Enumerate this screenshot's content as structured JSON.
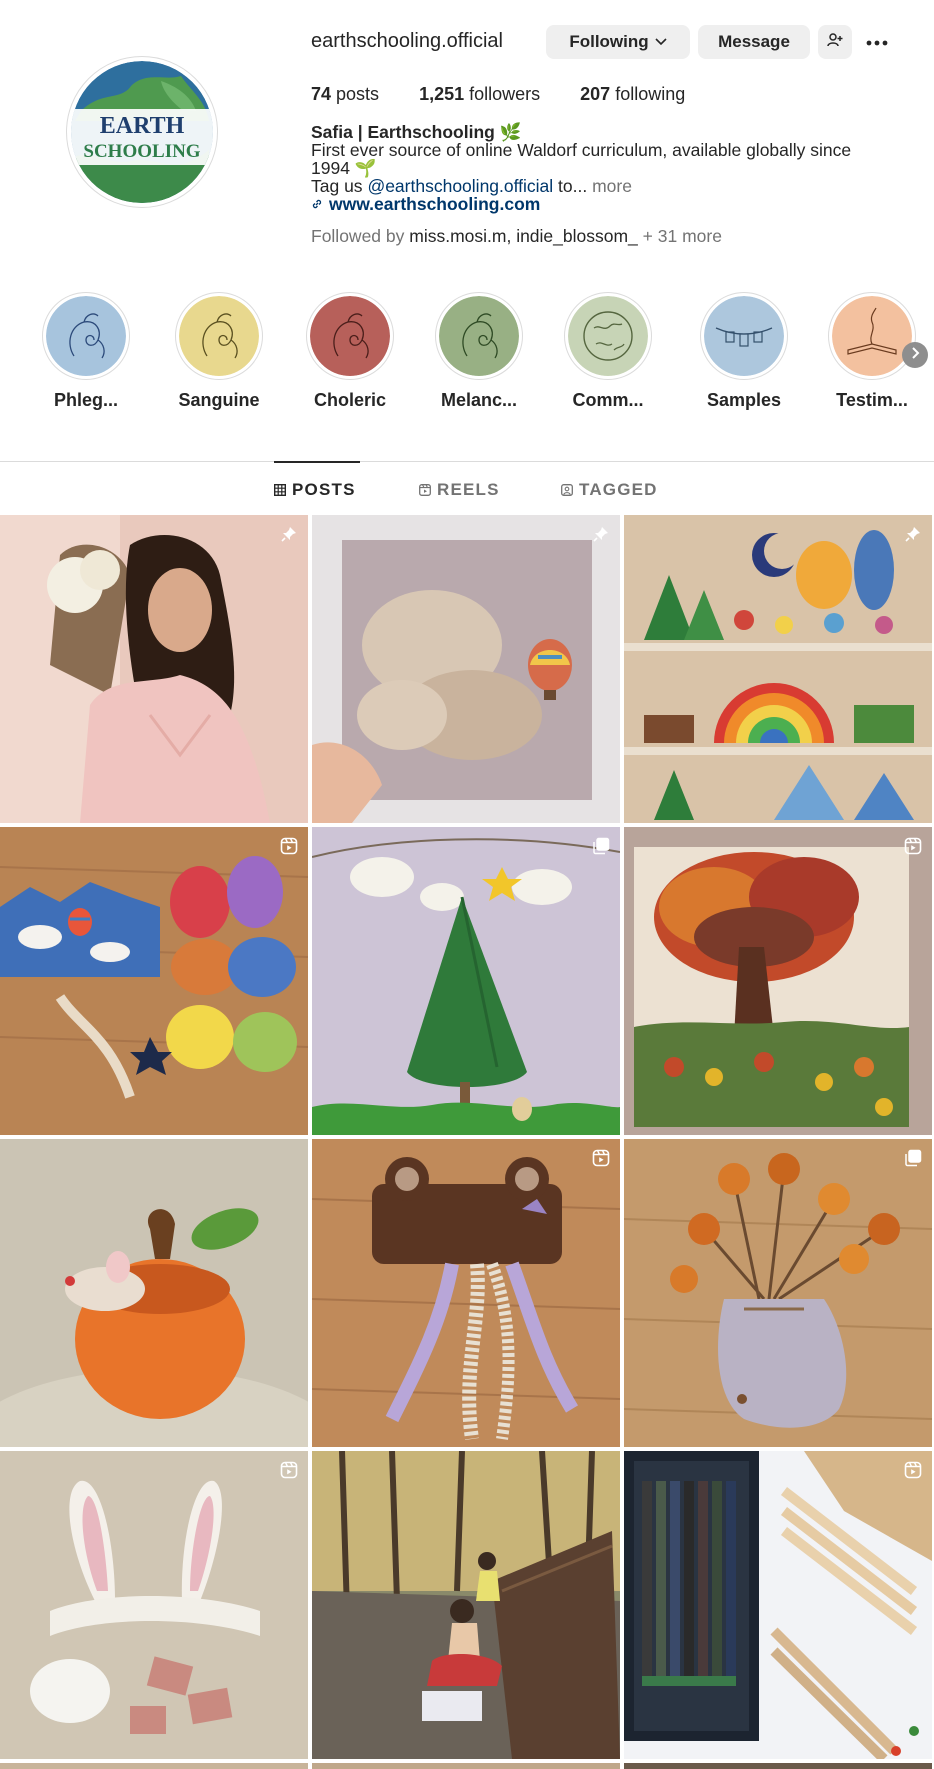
{
  "profile": {
    "username": "earthschooling.official",
    "logo_text_line1": "EARTH",
    "logo_text_line2": "SCHOOLING",
    "following_button": "Following",
    "message_button": "Message",
    "icons": {
      "suggest": "add-person-icon",
      "more": "more-dots-icon",
      "following_dropdown": "chevron-down-icon"
    }
  },
  "stats": {
    "posts_count": "74",
    "posts_label": " posts",
    "followers_count": "1,251",
    "followers_label": " followers",
    "following_count": "207",
    "following_label": " following"
  },
  "bio": {
    "name": "Safia | Earthschooling 🌿",
    "line1": "First ever source of online Waldorf curriculum, available globally since",
    "line2": "1994 🌱",
    "tag_prefix": "Tag us ",
    "mention": "@earthschooling.official",
    "tag_suffix": " to... ",
    "more": "more",
    "link": "www.earthschooling.com",
    "followed_prefix": "Followed by ",
    "followed_users": "miss.mosi.m, indie_blossom_",
    "followed_suffix": " + 31 more"
  },
  "highlights": [
    {
      "label": "Phleg...",
      "color": "#a7c4dd"
    },
    {
      "label": "Sanguine",
      "color": "#e8d88e"
    },
    {
      "label": "Choleric",
      "color": "#b7605a"
    },
    {
      "label": "Melanc...",
      "color": "#98b084"
    },
    {
      "label": "Comm...",
      "color": "#c7d4b6"
    },
    {
      "label": "Samples",
      "color": "#adc7dd"
    },
    {
      "label": "Testim...",
      "color": "#f3c19f"
    }
  ],
  "tabs": {
    "posts": "POSTS",
    "reels": "REELS",
    "tagged": "TAGGED"
  },
  "posts": [
    {
      "subject": "woman in pink dress with flower basket",
      "badge": "pin-icon"
    },
    {
      "subject": "felted cloud and hot air balloon",
      "badge": "pin-icon"
    },
    {
      "subject": "shelves of wooden toys",
      "badge": "pin-icon"
    },
    {
      "subject": "felted sky with balloon and wool",
      "badge": "reel-icon"
    },
    {
      "subject": "green felt tree with clouds",
      "badge": "carousel-icon"
    },
    {
      "subject": "felted autumn tree picture",
      "badge": "reel-icon"
    },
    {
      "subject": "felted mouse in pumpkin",
      "badge": ""
    },
    {
      "subject": "felt bear ears headband with ribbons",
      "badge": "reel-icon"
    },
    {
      "subject": "dried orange slices on branches in pouch",
      "badge": "carousel-icon"
    },
    {
      "subject": "bunny ears headband",
      "badge": "reel-icon"
    },
    {
      "subject": "girl drawing on wooden deck",
      "badge": ""
    },
    {
      "subject": "colored pencils",
      "badge": "reel-icon"
    }
  ]
}
